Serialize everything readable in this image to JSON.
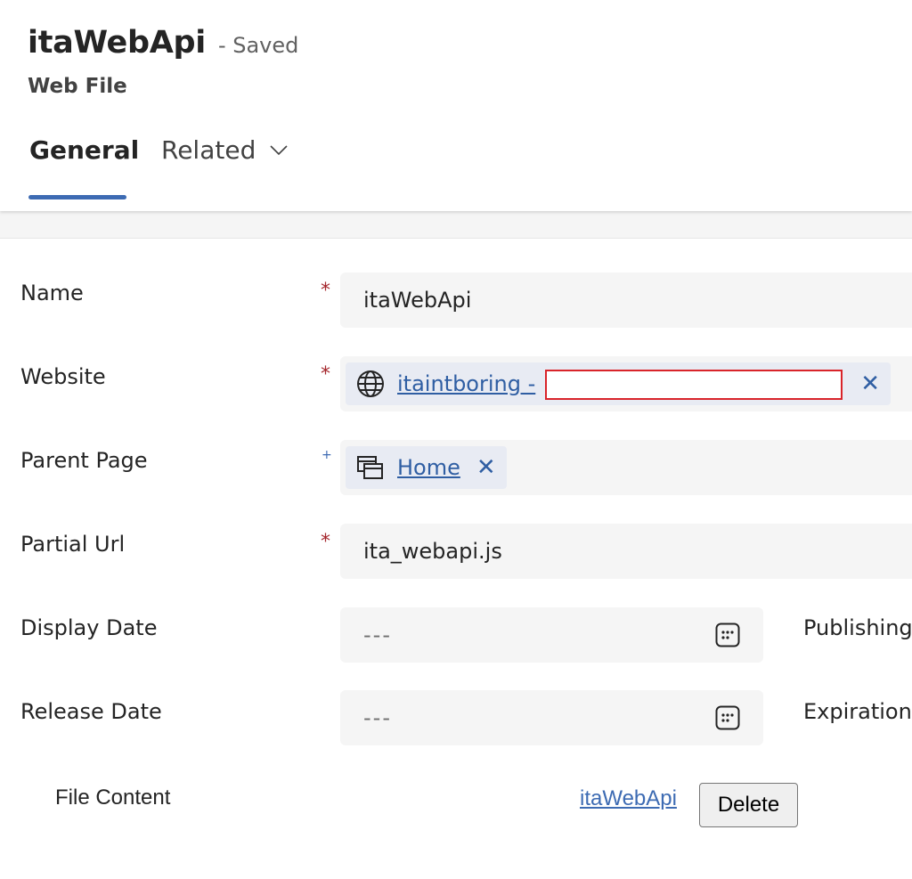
{
  "header": {
    "record_title": "itaWebApi",
    "save_status": "- Saved",
    "entity_name": "Web File"
  },
  "tabs": [
    {
      "label": "General",
      "selected": true
    },
    {
      "label": "Related",
      "selected": false
    }
  ],
  "colors": {
    "accent": "#3d6bb3",
    "required": "#a4262c",
    "link": "#2f5ea3",
    "redaction_border": "#d9242a"
  },
  "form": {
    "name": {
      "label": "Name",
      "required_marker": "*",
      "value": "itaWebApi"
    },
    "website": {
      "label": "Website",
      "required_marker": "*",
      "value": "itaintboring -",
      "icon": "globe-icon",
      "remove_glyph": "✕"
    },
    "parent_page": {
      "label": "Parent Page",
      "recommended_marker": "+",
      "value": "Home",
      "icon": "webpage-icon",
      "remove_glyph": "✕"
    },
    "partial_url": {
      "label": "Partial Url",
      "required_marker": "*",
      "value": "ita_webapi.js"
    },
    "display_date": {
      "label": "Display Date",
      "value": "---",
      "icon": "calendar-icon"
    },
    "publishing": {
      "label": "Publishing"
    },
    "release_date": {
      "label": "Release Date",
      "value": "---",
      "icon": "calendar-icon"
    },
    "expiration": {
      "label": "Expiration"
    }
  },
  "file_content": {
    "label": "File Content",
    "file_name": "itaWebApi",
    "delete_label": "Delete"
  }
}
